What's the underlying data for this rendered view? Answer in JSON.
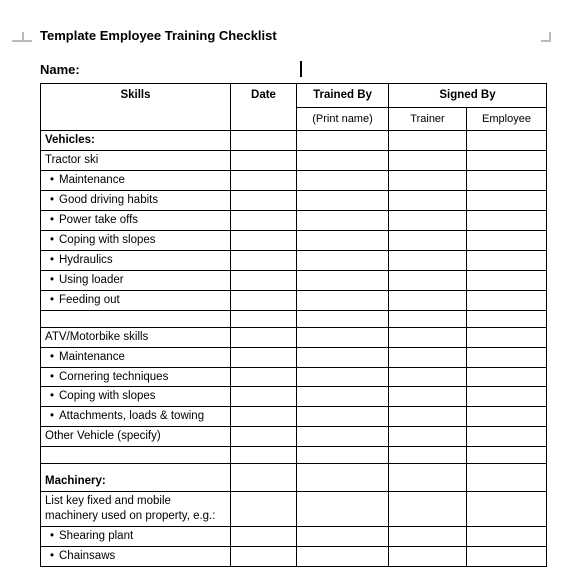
{
  "title": "Template Employee Training Checklist",
  "nameLabel": "Name:",
  "headers": {
    "skills": "Skills",
    "date": "Date",
    "trainedBy": "Trained By",
    "printName": "(Print name)",
    "signedBy": "Signed By",
    "trainer": "Trainer",
    "employee": "Employee"
  },
  "sections": [
    {
      "heading": "Vehicles:",
      "groups": [
        {
          "subheading": "Tractor ski",
          "items": [
            "Maintenance",
            "Good driving habits",
            "Power take offs",
            "Coping with slopes",
            "Hydraulics",
            "Using loader",
            "Feeding out"
          ]
        },
        {
          "subheading": "ATV/Motorbike skills",
          "items": [
            "Maintenance",
            "Cornering techniques",
            "Coping with slopes",
            "Attachments, loads & towing"
          ]
        },
        {
          "subheading": "Other Vehicle (specify)",
          "items": []
        }
      ]
    },
    {
      "heading": "Machinery:",
      "groups": [
        {
          "subheading": "List key fixed and mobile machinery used on property, e.g.:",
          "items": [
            "Shearing plant",
            "Chainsaws"
          ]
        }
      ]
    }
  ]
}
